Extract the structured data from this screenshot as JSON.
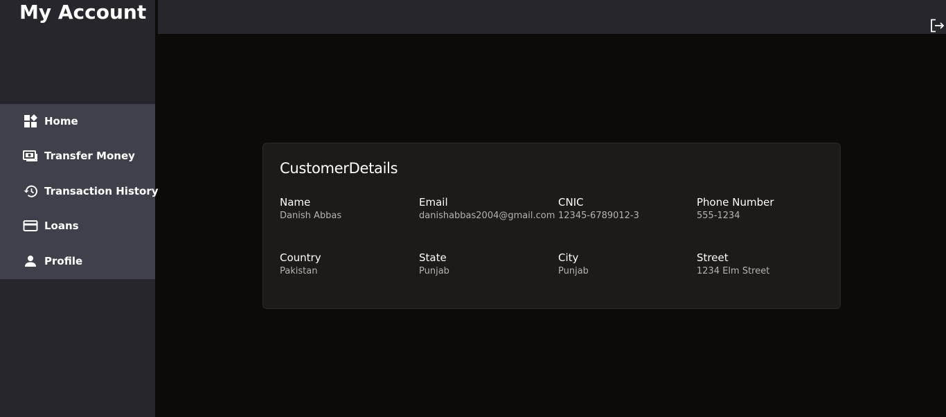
{
  "app": {
    "title": "My Account"
  },
  "sidebar": {
    "items": [
      {
        "label": "Home",
        "icon": "dashboard-icon"
      },
      {
        "label": "Transfer Money",
        "icon": "money-transfer-icon"
      },
      {
        "label": "Transaction History",
        "icon": "history-icon"
      },
      {
        "label": "Loans",
        "icon": "credit-card-icon"
      },
      {
        "label": "Profile",
        "icon": "person-icon"
      }
    ]
  },
  "topbar": {
    "logout_icon": "logout-icon"
  },
  "customer": {
    "title": "CustomerDetails",
    "fields": [
      {
        "label": "Name",
        "value": "Danish Abbas"
      },
      {
        "label": "Email",
        "value": "danishabbas2004@gmail.com"
      },
      {
        "label": "CNIC",
        "value": "12345-6789012-3"
      },
      {
        "label": "Phone Number",
        "value": "555-1234"
      },
      {
        "label": "Country",
        "value": "Pakistan"
      },
      {
        "label": "State",
        "value": "Punjab"
      },
      {
        "label": "City",
        "value": "Punjab"
      },
      {
        "label": "Street",
        "value": "1234 Elm Street"
      }
    ]
  },
  "colors": {
    "background": "#0c0b0a",
    "sidebar": "#27262c",
    "nav_block": "#40404b",
    "card": "#1d1a18",
    "text_primary": "#ffffff",
    "text_secondary": "#b5b3b0"
  }
}
